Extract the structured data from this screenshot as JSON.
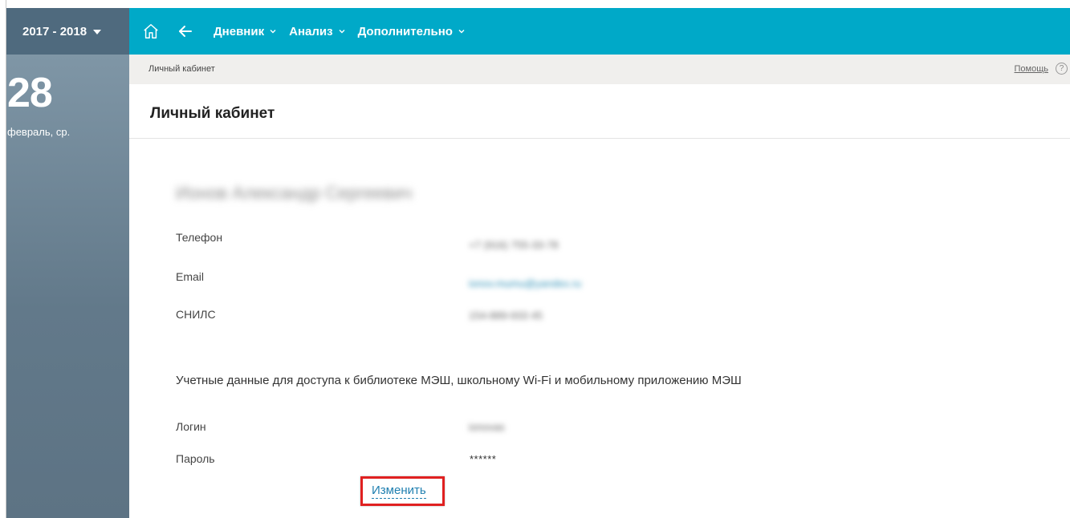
{
  "year_selector": {
    "label": "2017 - 2018"
  },
  "nav": {
    "items": [
      {
        "label": "Дневник"
      },
      {
        "label": "Анализ"
      },
      {
        "label": "Дополнительно"
      }
    ]
  },
  "date": {
    "day": "28",
    "month_weekday": "февраль, ср."
  },
  "breadcrumb": {
    "current": "Личный кабинет",
    "help": "Помощь",
    "help_icon": "?"
  },
  "page": {
    "title": "Личный кабинет"
  },
  "profile": {
    "full_name": "Ионов Александр Сергеевич",
    "phone": {
      "label": "Телефон",
      "value": "+7 (916) 755-33-78"
    },
    "email": {
      "label": "Email",
      "value": "ionov.mumu@yandex.ru"
    },
    "snils": {
      "label": "СНИЛС",
      "value": "154-889-933 45"
    }
  },
  "credentials": {
    "heading": "Учетные данные для доступа к библиотеке МЭШ, школьному Wi-Fi и мобильному приложению МЭШ",
    "login": {
      "label": "Логин",
      "value": "ionovas"
    },
    "password": {
      "label": "Пароль",
      "value": "******"
    },
    "change_link": "Изменить"
  },
  "colors": {
    "topbar": "#00a9c8",
    "year_block": "#4f6a7e",
    "sidebar": "#6f8696",
    "highlight_border": "#e02020",
    "link": "#1f7fb0"
  },
  "icons": [
    "home-icon",
    "back-arrow-icon",
    "chevron-down-icon",
    "help-icon"
  ]
}
